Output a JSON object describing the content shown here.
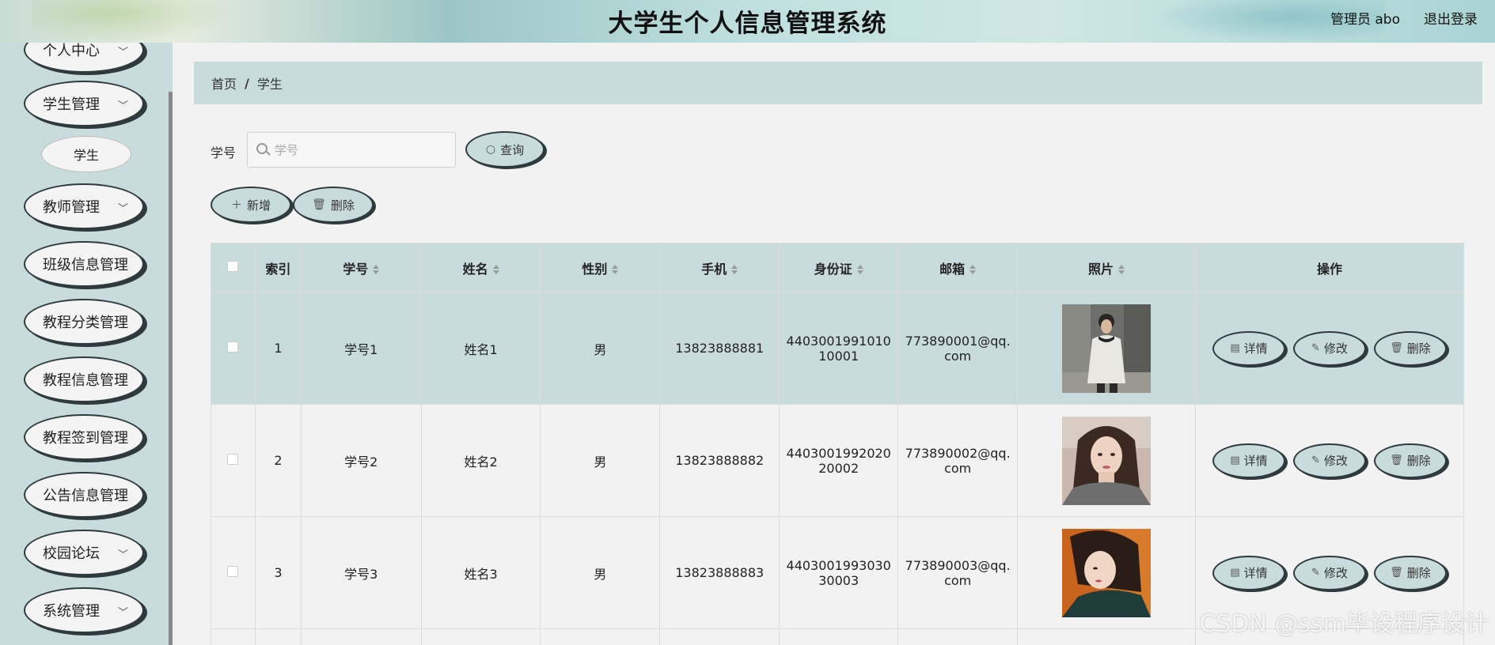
{
  "header": {
    "title": "大学生个人信息管理系统",
    "user_label": "管理员 abo",
    "logout_label": "退出登录"
  },
  "sidebar": {
    "items": [
      {
        "label": "个人中心",
        "expandable": true
      },
      {
        "label": "学生管理",
        "expandable": true
      },
      {
        "label": "学生",
        "sub": true
      },
      {
        "label": "教师管理",
        "expandable": true
      },
      {
        "label": "班级信息管理",
        "expandable": false
      },
      {
        "label": "教程分类管理",
        "expandable": false
      },
      {
        "label": "教程信息管理",
        "expandable": false
      },
      {
        "label": "教程签到管理",
        "expandable": false
      },
      {
        "label": "公告信息管理",
        "expandable": false
      },
      {
        "label": "校园论坛",
        "expandable": true
      },
      {
        "label": "系统管理",
        "expandable": true
      }
    ]
  },
  "breadcrumb": {
    "home": "首页",
    "separator": "/",
    "current": "学生"
  },
  "search": {
    "label": "学号",
    "placeholder": "学号",
    "value": "",
    "button": "查询"
  },
  "actions": {
    "add": "新增",
    "delete": "删除"
  },
  "table": {
    "columns": [
      "索引",
      "学号",
      "姓名",
      "性别",
      "手机",
      "身份证",
      "邮箱",
      "照片",
      "操作"
    ],
    "rows": [
      {
        "index": "1",
        "student_no": "学号1",
        "name": "姓名1",
        "gender": "男",
        "phone": "13823888881",
        "id_card_l1": "4403001991010",
        "id_card_l2": "10001",
        "email_l1": "773890001@qq.",
        "email_l2": "com",
        "photo": "photo-1"
      },
      {
        "index": "2",
        "student_no": "学号2",
        "name": "姓名2",
        "gender": "男",
        "phone": "13823888882",
        "id_card_l1": "4403001992020",
        "id_card_l2": "20002",
        "email_l1": "773890002@qq.",
        "email_l2": "com",
        "photo": "photo-2"
      },
      {
        "index": "3",
        "student_no": "学号3",
        "name": "姓名3",
        "gender": "男",
        "phone": "13823888883",
        "id_card_l1": "4403001993030",
        "id_card_l2": "30003",
        "email_l1": "773890003@qq.",
        "email_l2": "com",
        "photo": "photo-3"
      }
    ],
    "row_ops": {
      "detail": "详情",
      "edit": "修改",
      "delete": "删除"
    }
  },
  "icons": {
    "chevron": "chevron-down-icon",
    "search": "search-icon",
    "plus": "plus-icon",
    "trash": "trash-icon",
    "doc": "document-icon",
    "pencil": "pencil-icon"
  },
  "colors": {
    "accent": "#c8dbdd",
    "border_dark": "#2f3a3f",
    "background": "#f2f2f2"
  },
  "watermark": "CSDN @ssm毕设程序设计"
}
